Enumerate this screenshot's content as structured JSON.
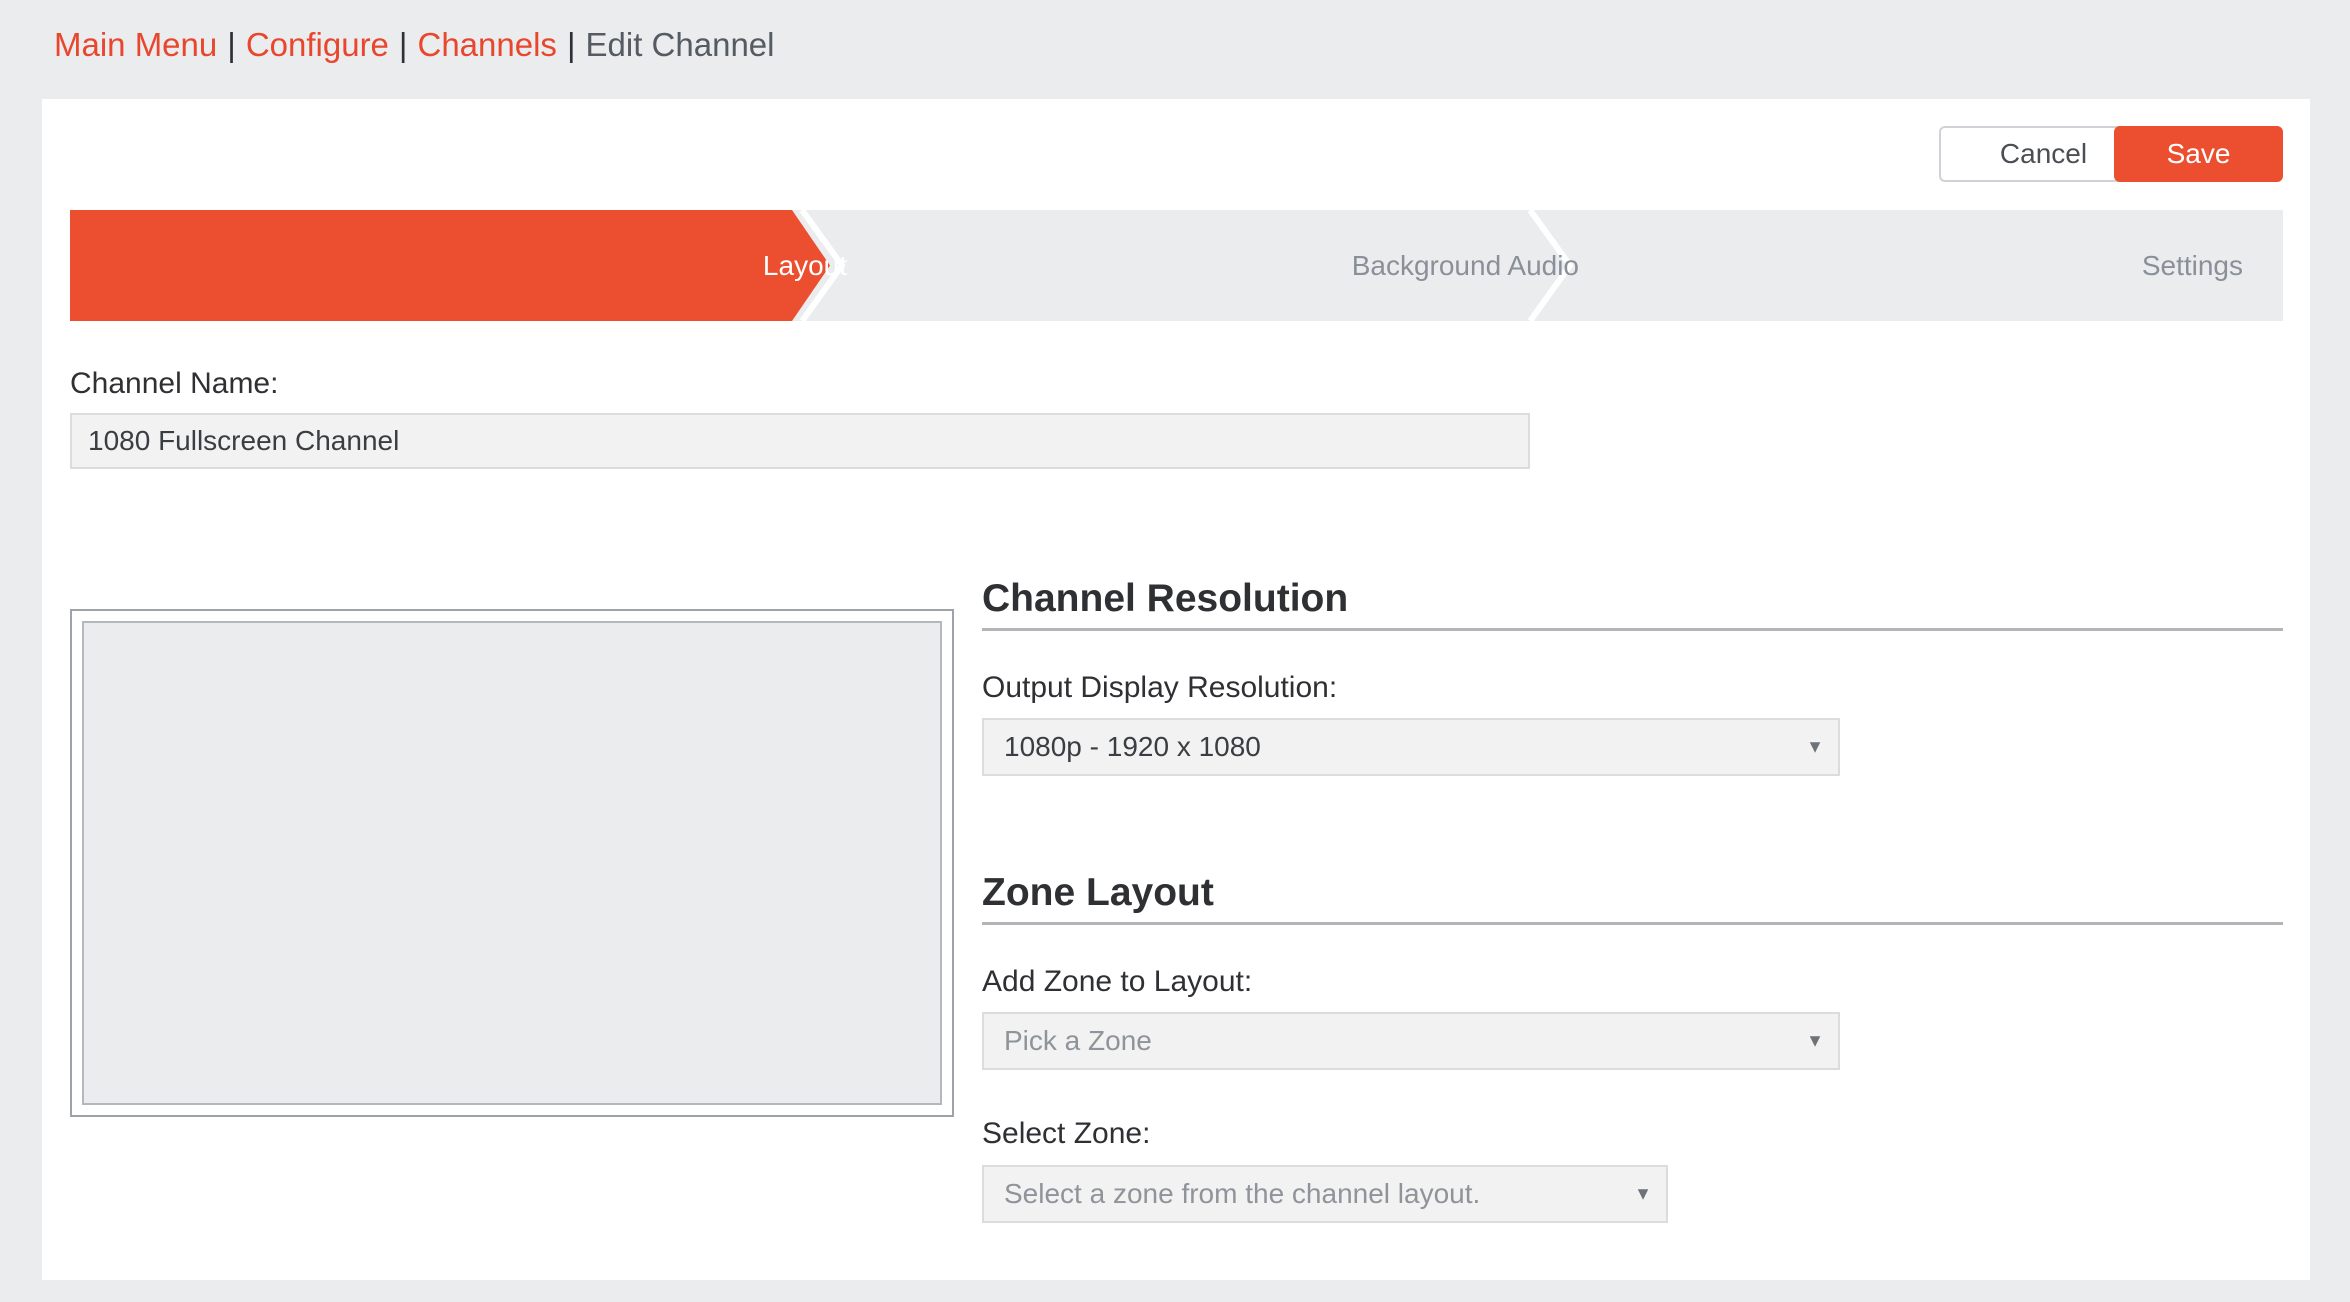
{
  "breadcrumb": {
    "items": [
      {
        "label": "Main Menu"
      },
      {
        "label": "Configure"
      },
      {
        "label": "Channels"
      }
    ],
    "separator": "|",
    "current": "Edit Channel"
  },
  "actions": {
    "cancel_label": "Cancel",
    "save_label": "Save"
  },
  "wizard": {
    "steps": [
      {
        "label": "Layout",
        "active": true
      },
      {
        "label": "Background Audio",
        "active": false
      },
      {
        "label": "Settings",
        "active": false
      }
    ]
  },
  "channel_name": {
    "label": "Channel Name:",
    "value": "1080 Fullscreen Channel"
  },
  "resolution": {
    "title": "Channel Resolution",
    "output_label": "Output Display Resolution:",
    "output_value": "1080p - 1920 x 1080"
  },
  "zone_layout": {
    "title": "Zone Layout",
    "add_label": "Add Zone to Layout:",
    "add_placeholder": "Pick a Zone",
    "select_label": "Select Zone:",
    "select_placeholder": "Select a zone from the channel layout."
  },
  "icons": {
    "dropdown": "chevron-down-icon",
    "caret_glyph": "▼"
  },
  "colors": {
    "accent": "#ec4f30",
    "link": "#e8472d",
    "step_inactive_bg": "#ebecee",
    "page_bg": "#ebecee"
  }
}
